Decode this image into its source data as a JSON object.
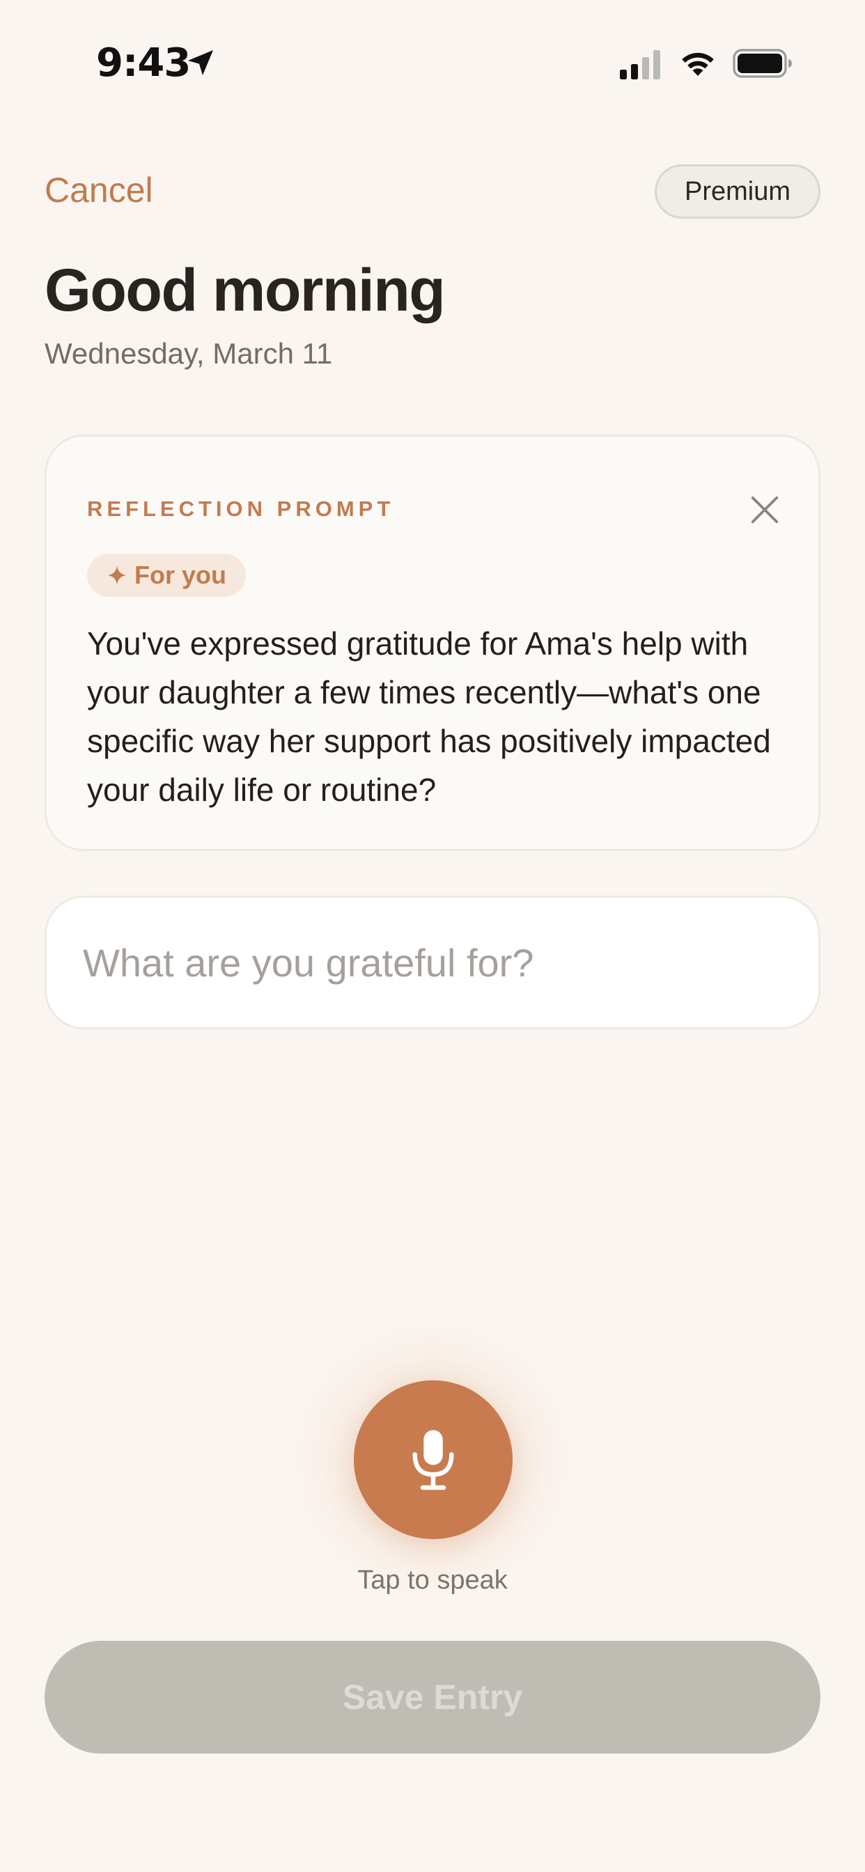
{
  "status_bar": {
    "time": "9:43"
  },
  "header": {
    "cancel_label": "Cancel",
    "premium_label": "Premium",
    "greeting": "Good morning",
    "date": "Wednesday, March 11"
  },
  "prompt_card": {
    "label": "REFLECTION PROMPT",
    "chip_label": "For you",
    "text": "You've expressed gratitude for Ama's help with your daughter a few times recently—what's one specific way her support has positively impacted your daily life or routine?"
  },
  "entry": {
    "placeholder": "What are you grateful for?",
    "value": ""
  },
  "voice": {
    "hint": "Tap to speak"
  },
  "footer": {
    "save_label": "Save Entry"
  },
  "colors": {
    "accent": "#c77b4f",
    "background": "#faf5f0",
    "disabled_button": "#bdbdb4"
  },
  "icons": [
    "location-arrow-icon",
    "signal-icon",
    "wifi-icon",
    "battery-icon",
    "close-icon",
    "sparkle-icon",
    "microphone-icon"
  ]
}
